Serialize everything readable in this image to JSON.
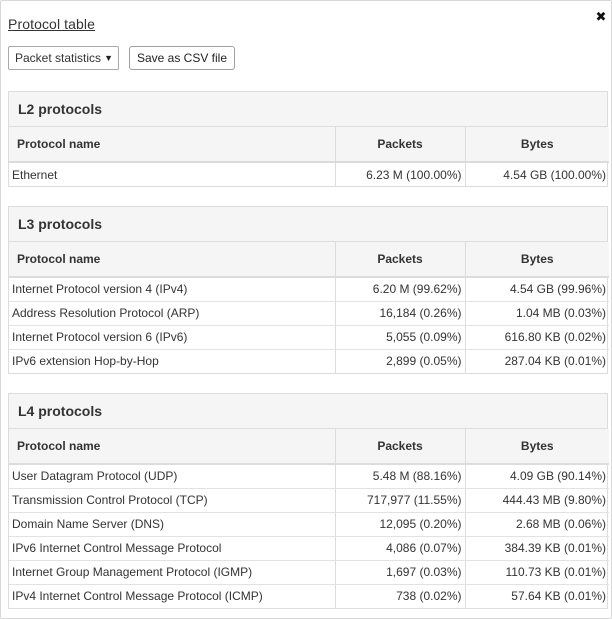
{
  "title": "Protocol table",
  "close_glyph": "✖",
  "toolbar": {
    "select_value": "Packet statistics",
    "select_arrow": "▼",
    "csv_button": "Save as CSV file"
  },
  "columns": {
    "name": "Protocol name",
    "packets": "Packets",
    "bytes": "Bytes"
  },
  "sections": [
    {
      "title": "L2 protocols",
      "rows": [
        {
          "name": "Ethernet",
          "packets": "6.23 M (100.00%)",
          "bytes": "4.54 GB (100.00%)"
        }
      ]
    },
    {
      "title": "L3 protocols",
      "rows": [
        {
          "name": "Internet Protocol version 4 (IPv4)",
          "packets": "6.20 M (99.62%)",
          "bytes": "4.54 GB (99.96%)"
        },
        {
          "name": "Address Resolution Protocol (ARP)",
          "packets": "16,184 (0.26%)",
          "bytes": "1.04 MB (0.03%)"
        },
        {
          "name": "Internet Protocol version 6 (IPv6)",
          "packets": "5,055 (0.09%)",
          "bytes": "616.80 KB (0.02%)"
        },
        {
          "name": "IPv6 extension Hop-by-Hop",
          "packets": "2,899 (0.05%)",
          "bytes": "287.04 KB (0.01%)"
        }
      ]
    },
    {
      "title": "L4 protocols",
      "rows": [
        {
          "name": "User Datagram Protocol (UDP)",
          "packets": "5.48 M (88.16%)",
          "bytes": "4.09 GB (90.14%)"
        },
        {
          "name": "Transmission Control Protocol (TCP)",
          "packets": "717,977 (11.55%)",
          "bytes": "444.43 MB (9.80%)"
        },
        {
          "name": "Domain Name Server (DNS)",
          "packets": "12,095 (0.20%)",
          "bytes": "2.68 MB (0.06%)"
        },
        {
          "name": "IPv6 Internet Control Message Protocol",
          "packets": "4,086 (0.07%)",
          "bytes": "384.39 KB (0.01%)"
        },
        {
          "name": "Internet Group Management Protocol (IGMP)",
          "packets": "1,697 (0.03%)",
          "bytes": "110.73 KB (0.01%)"
        },
        {
          "name": "IPv4 Internet Control Message Protocol (ICMP)",
          "packets": "738 (0.02%)",
          "bytes": "57.64 KB (0.01%)"
        }
      ]
    }
  ]
}
